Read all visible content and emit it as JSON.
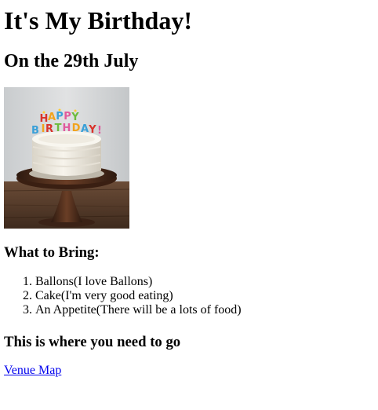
{
  "page": {
    "title": "It's My Birthday!",
    "subtitle": "On the 29th July"
  },
  "image": {
    "alt": "Birthday cake",
    "cake_topper_letters": "HAPPY BIRTHDAY!",
    "colors": {
      "wall": "#d7d9db",
      "table": "#5c4030",
      "stand": "#4a2a1a",
      "frosting": "#f3efe6"
    }
  },
  "bring": {
    "heading": "What to Bring:",
    "items": [
      "Ballons(I love Ballons)",
      "Cake(I'm very good eating)",
      "An Appetite(There will be a lots of food)"
    ]
  },
  "venue": {
    "heading": "This is where you need to go",
    "link_text": "Venue Map",
    "link_color": "#0000ee"
  }
}
